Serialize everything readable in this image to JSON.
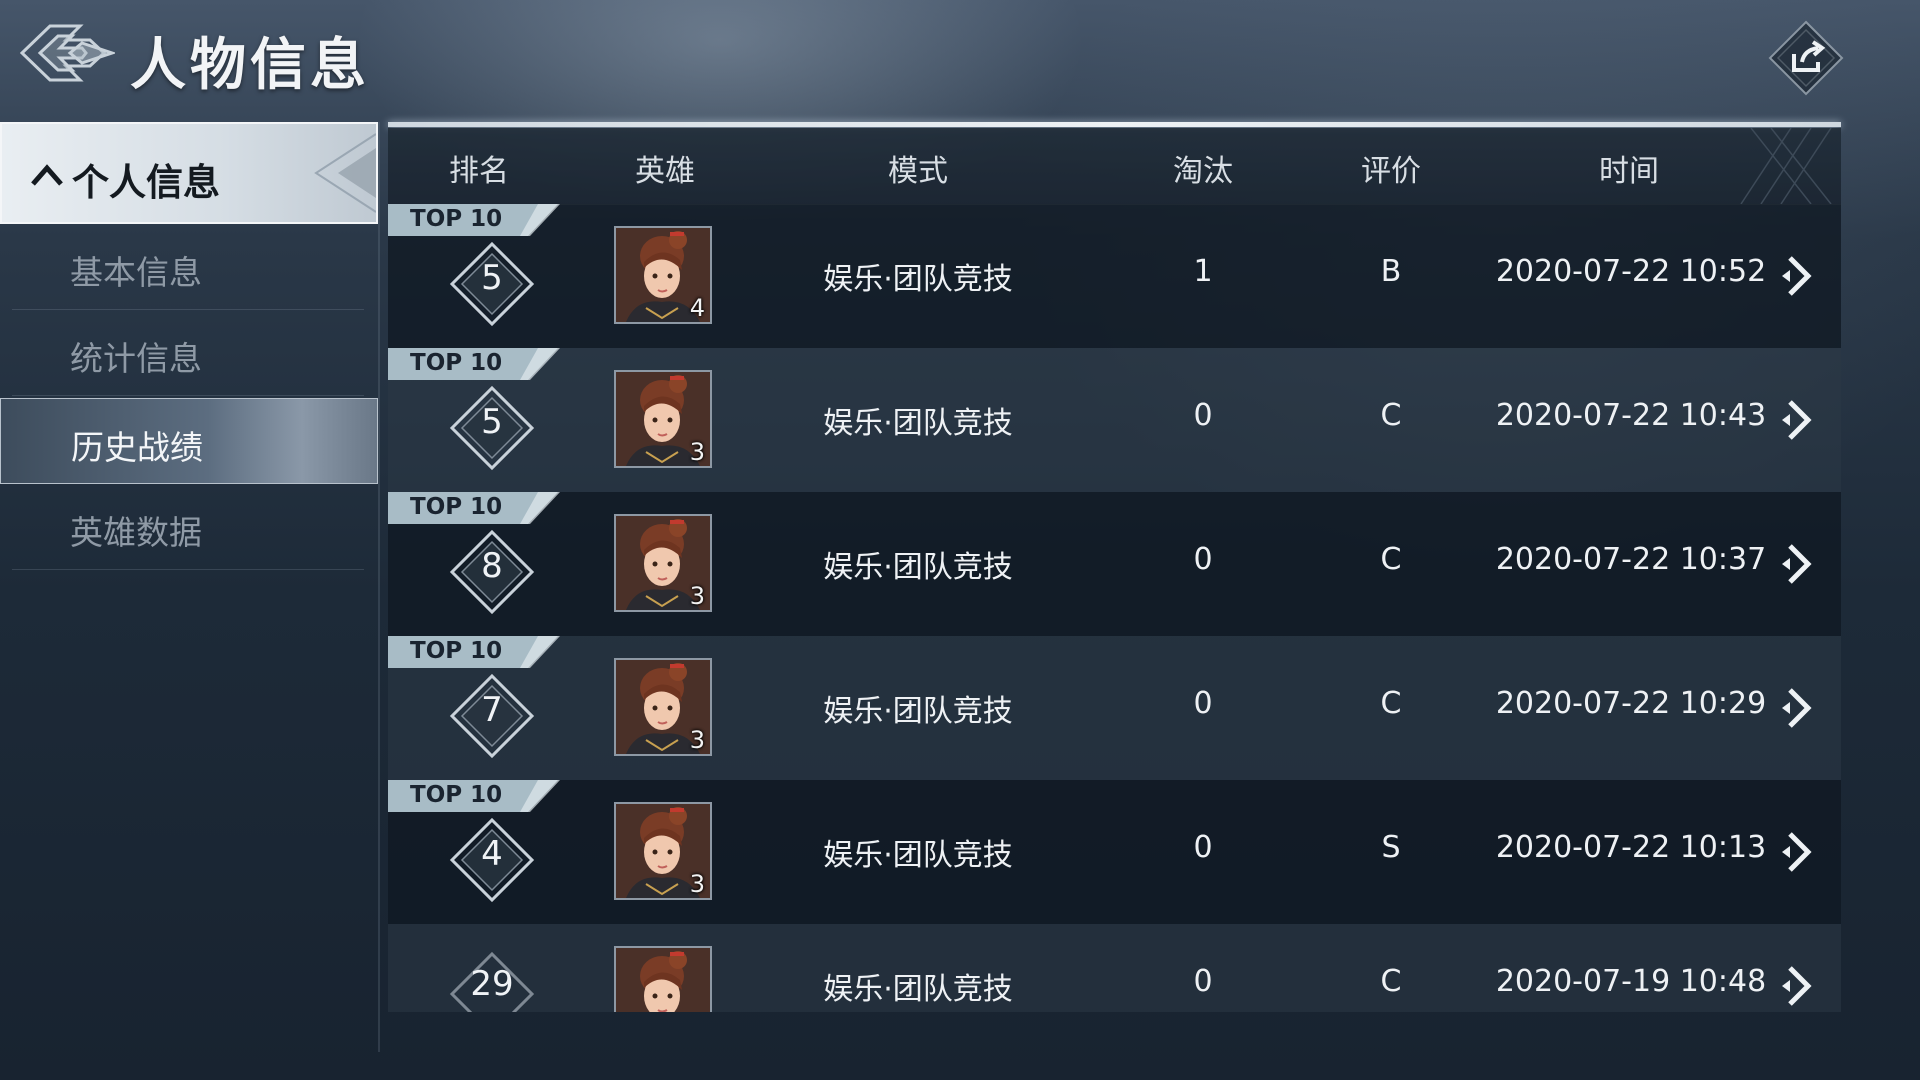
{
  "header": {
    "title": "人物信息",
    "logo_icon": "winged-emblem-icon",
    "share_icon": "share-export-icon"
  },
  "sidebar": {
    "section_label": "个人信息",
    "section_icon": "chevron-up-icon",
    "items": [
      {
        "label": "基本信息",
        "active": false
      },
      {
        "label": "统计信息",
        "active": false
      },
      {
        "label": "历史战绩",
        "active": true
      },
      {
        "label": "英雄数据",
        "active": false
      }
    ]
  },
  "table": {
    "columns": [
      "排名",
      "英雄",
      "模式",
      "淘汰",
      "评价",
      "时间"
    ],
    "rows": [
      {
        "tag": "TOP 10",
        "rank": "5",
        "hero_level": "4",
        "mode": "娱乐·团队竞技",
        "eliminations": "1",
        "rating": "B",
        "time": "2020-07-22 10:52"
      },
      {
        "tag": "TOP 10",
        "rank": "5",
        "hero_level": "3",
        "mode": "娱乐·团队竞技",
        "eliminations": "0",
        "rating": "C",
        "time": "2020-07-22 10:43"
      },
      {
        "tag": "TOP 10",
        "rank": "8",
        "hero_level": "3",
        "mode": "娱乐·团队竞技",
        "eliminations": "0",
        "rating": "C",
        "time": "2020-07-22 10:37"
      },
      {
        "tag": "TOP 10",
        "rank": "7",
        "hero_level": "3",
        "mode": "娱乐·团队竞技",
        "eliminations": "0",
        "rating": "C",
        "time": "2020-07-22 10:29"
      },
      {
        "tag": "TOP 10",
        "rank": "4",
        "hero_level": "3",
        "mode": "娱乐·团队竞技",
        "eliminations": "0",
        "rating": "S",
        "time": "2020-07-22 10:13"
      },
      {
        "tag": "",
        "rank": "29",
        "hero_level": "",
        "mode": "娱乐·团队竞技",
        "eliminations": "0",
        "rating": "C",
        "time": "2020-07-19 10:48"
      }
    ]
  },
  "colors": {
    "accent": "#cfdde6",
    "row_dark": "#101822",
    "row_light": "#2c3846"
  }
}
